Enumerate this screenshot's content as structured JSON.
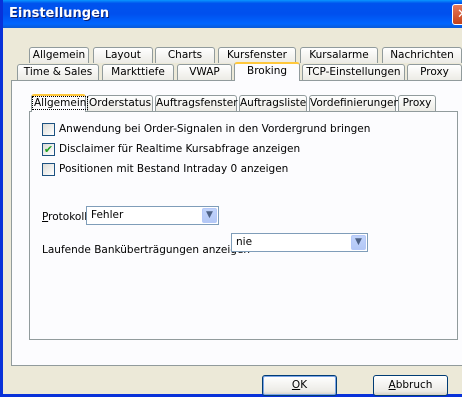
{
  "window": {
    "title": "Einstellungen",
    "close_glyph": "✕"
  },
  "tabs_row1": [
    "Allgemein",
    "Layout",
    "Charts",
    "Kursfenster",
    "Kursalarme",
    "Nachrichten"
  ],
  "tabs_row2": [
    "Time & Sales",
    "Markttiefe",
    "VWAP",
    "Broking",
    "TCP-Einstellungen",
    "Proxy"
  ],
  "selected_outer_tab": "Broking",
  "inner_tabs": [
    "Allgemein",
    "Orderstatus",
    "Auftragsfenster",
    "Auftragsliste",
    "Vordefinierungen",
    "Proxy"
  ],
  "selected_inner_tab": "Allgemein",
  "options": [
    {
      "label": "Anwendung bei Order-Signalen in den Vordergrund bringen",
      "checked": false
    },
    {
      "label": "Disclaimer für Realtime Kursabfrage anzeigen",
      "checked": true
    },
    {
      "label": "Positionen mit Bestand Intraday 0 anzeigen",
      "checked": false
    }
  ],
  "protokoll": {
    "label_accel": "P",
    "label_rest": "rotokoll",
    "value": "Fehler"
  },
  "bankuebertragungen": {
    "label": "Laufende Banküberträgungen anzeigen",
    "value": "nie"
  },
  "buttons": {
    "ok_accel": "O",
    "ok_rest": "K",
    "cancel_accel": "A",
    "cancel_rest": "bbruch"
  },
  "icons": {
    "checkmark": "✔",
    "dropdown": "▼"
  }
}
